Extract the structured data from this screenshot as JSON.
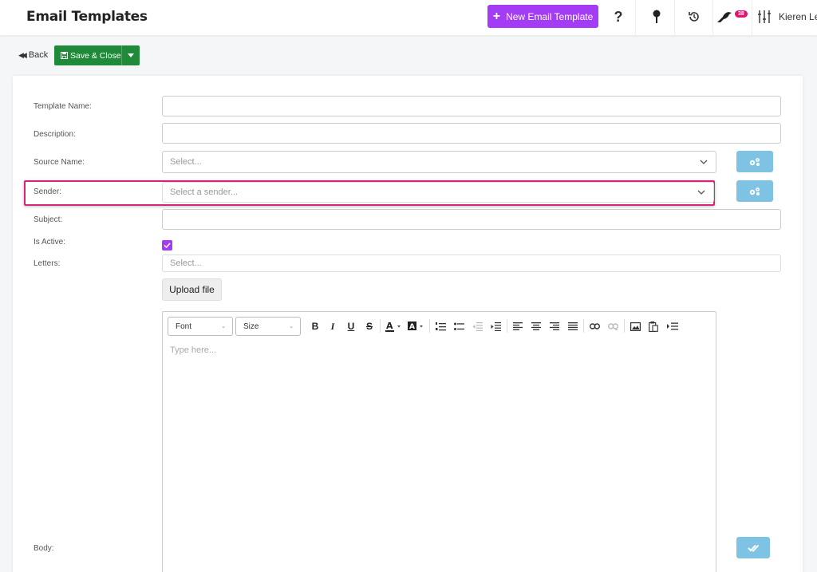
{
  "header": {
    "title": "Email Templates",
    "new_button_label": "New Email Template",
    "notification_count": "38",
    "user_name": "Kieren Le C"
  },
  "actions": {
    "back_label": "Back",
    "save_label": "Save & Close"
  },
  "form": {
    "template_name": {
      "label": "Template Name:",
      "value": ""
    },
    "description": {
      "label": "Description:",
      "value": ""
    },
    "source_name": {
      "label": "Source Name:",
      "placeholder": "Select..."
    },
    "sender": {
      "label": "Sender:",
      "placeholder": "Select a sender..."
    },
    "subject": {
      "label": "Subject:",
      "value": ""
    },
    "is_active": {
      "label": "Is Active:",
      "checked": true
    },
    "letters": {
      "label": "Letters:",
      "placeholder": "Select..."
    },
    "upload_label": "Upload file",
    "body": {
      "label": "Body:",
      "placeholder": "Type here..."
    }
  },
  "editor": {
    "font_label": "Font",
    "size_label": "Size",
    "bold": "B",
    "italic": "I",
    "underline": "U",
    "strike": "S"
  },
  "colors": {
    "accent": "#a43cf5",
    "save": "#1f8a37",
    "highlight": "#d6247a",
    "info_button": "#7ec3e4",
    "badge": "#e6106e"
  }
}
